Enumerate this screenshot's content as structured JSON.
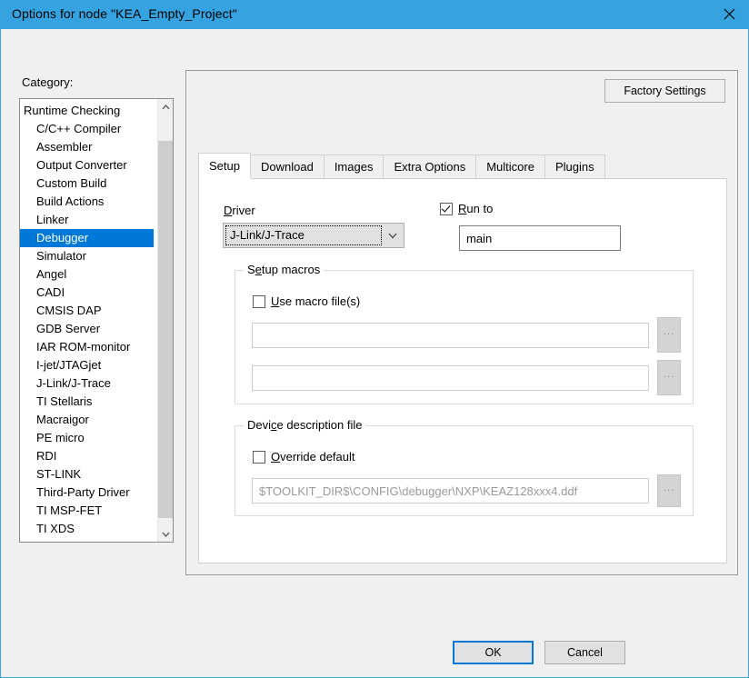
{
  "window": {
    "title": "Options for node \"KEA_Empty_Project\"",
    "close_icon": "close-icon",
    "titlebar_color": "#35a3e0"
  },
  "category": {
    "label": "Category:",
    "selected": "Debugger",
    "items": [
      {
        "label": "Runtime Checking",
        "indent": false
      },
      {
        "label": "C/C++ Compiler",
        "indent": true
      },
      {
        "label": "Assembler",
        "indent": true
      },
      {
        "label": "Output Converter",
        "indent": true
      },
      {
        "label": "Custom Build",
        "indent": true
      },
      {
        "label": "Build Actions",
        "indent": true
      },
      {
        "label": "Linker",
        "indent": true
      },
      {
        "label": "Debugger",
        "indent": true
      },
      {
        "label": "Simulator",
        "indent": true
      },
      {
        "label": "Angel",
        "indent": true
      },
      {
        "label": "CADI",
        "indent": true
      },
      {
        "label": "CMSIS DAP",
        "indent": true
      },
      {
        "label": "GDB Server",
        "indent": true
      },
      {
        "label": "IAR ROM-monitor",
        "indent": true
      },
      {
        "label": "I-jet/JTAGjet",
        "indent": true
      },
      {
        "label": "J-Link/J-Trace",
        "indent": true
      },
      {
        "label": "TI Stellaris",
        "indent": true
      },
      {
        "label": "Macraigor",
        "indent": true
      },
      {
        "label": "PE micro",
        "indent": true
      },
      {
        "label": "RDI",
        "indent": true
      },
      {
        "label": "ST-LINK",
        "indent": true
      },
      {
        "label": "Third-Party Driver",
        "indent": true
      },
      {
        "label": "TI MSP-FET",
        "indent": true
      },
      {
        "label": "TI XDS",
        "indent": true
      }
    ],
    "scrollbar": {
      "up_icon": "chevron-up-icon",
      "down_icon": "chevron-down-icon"
    },
    "selected_color": "#0078d7"
  },
  "panel": {
    "factory_settings_label": "Factory Settings",
    "tabs": [
      {
        "label": "Setup",
        "active": true
      },
      {
        "label": "Download",
        "active": false
      },
      {
        "label": "Images",
        "active": false
      },
      {
        "label": "Extra Options",
        "active": false
      },
      {
        "label": "Multicore",
        "active": false
      },
      {
        "label": "Plugins",
        "active": false
      }
    ]
  },
  "setup": {
    "driver": {
      "label": "Driver",
      "value": "J-Link/J-Trace",
      "arrow_icon": "chevron-down-icon"
    },
    "run_to": {
      "label": "Run to",
      "checked": true,
      "value": "main"
    },
    "setup_macros": {
      "title": "Setup macros",
      "use_macro_files": {
        "label": "Use macro file(s)",
        "checked": false
      },
      "macro_file_1": "",
      "macro_file_2": "",
      "browse_label": "...",
      "browse_icon": "ellipsis-icon"
    },
    "device_description_file": {
      "title": "Device description file",
      "override_default": {
        "label": "Override default",
        "checked": false
      },
      "path": "$TOOLKIT_DIR$\\CONFIG\\debugger\\NXP\\KEAZ128xxx4.ddf",
      "path_disabled": true,
      "browse_label": "...",
      "browse_icon": "ellipsis-icon"
    }
  },
  "footer": {
    "ok_label": "OK",
    "cancel_label": "Cancel",
    "focus_color": "#0078d7"
  }
}
